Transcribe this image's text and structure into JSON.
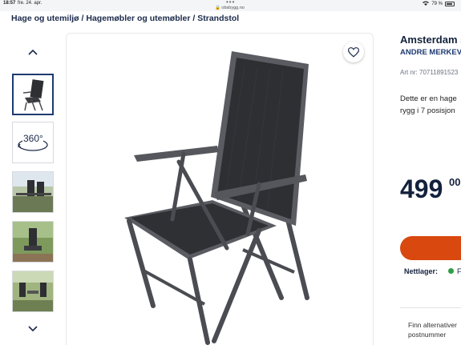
{
  "status_bar": {
    "time": "18:57",
    "date": "fre. 24. apr.",
    "url": "obsbygg.no",
    "battery": "79 %"
  },
  "breadcrumb": {
    "items": [
      "Hage og utemiljø",
      "Hagemøbler og utemøbler",
      "Strandstol"
    ],
    "separator": " / "
  },
  "gallery": {
    "thumbnails": [
      "chair-product-photo",
      "360-view",
      "chair-on-balcony-photo",
      "chair-in-garden-photo",
      "chairs-on-terrace-photo"
    ],
    "view360_label": "360°",
    "active_index": 0
  },
  "product": {
    "title": "Amsterdam st",
    "brand": "ANDRE MERKEV",
    "art_nr": "Art nr: 70711891523",
    "description_line1": "Dette er en hage",
    "description_line2": "rygg i 7 posisjon",
    "price": "499",
    "price_decimals": "00",
    "stock_label": "Nettlager:",
    "stock_status": "F",
    "find_line1": "Finn alternativer",
    "find_line2": "postnummer"
  },
  "colors": {
    "accent": "#d9480f",
    "brand_navy": "#1d3a72",
    "stock_ok": "#2f9e44",
    "chair_frame": "#4a4c52",
    "chair_mesh": "#2e2f33"
  }
}
